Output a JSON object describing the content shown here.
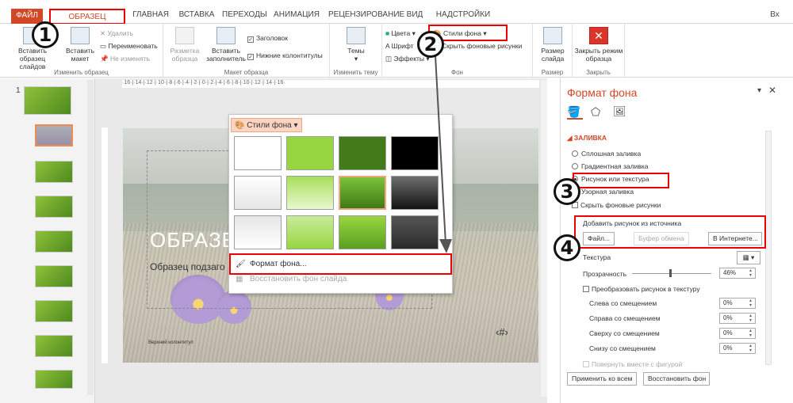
{
  "tabs": {
    "file": "ФАЙЛ",
    "items": [
      "ОБРАЗЕЦ СЛАЙДОВ",
      "ГЛАВНАЯ",
      "ВСТАВКА",
      "ПЕРЕХОДЫ",
      "АНИМАЦИЯ",
      "РЕЦЕНЗИРОВАНИЕ",
      "ВИД",
      "НАДСТРОЙКИ"
    ],
    "signin": "Вх"
  },
  "ribbon": {
    "edit_master": {
      "insert_master": "Вставить образец слайдов",
      "insert_layout": "Вставить макет",
      "delete": "Удалить",
      "rename": "Переименовать",
      "preserve": "Не изменять",
      "label": "Изменить образец"
    },
    "layout": {
      "master_layout": "Разметка образца",
      "insert_placeholder": "Вставить заполнитель",
      "title": "Заголовок",
      "footers": "Нижние колонтитулы",
      "label": "Макет образца"
    },
    "theme": {
      "themes": "Темы",
      "label": "Изменить тему"
    },
    "background": {
      "colors": "Цвета",
      "fonts": "Шрифт",
      "effects": "Эффекты",
      "bg_styles": "Стили фона",
      "hide_bg": "Скрыть фоновые рисунки",
      "label": "Фон"
    },
    "size": {
      "slide_size": "Размер слайда",
      "label": "Размер"
    },
    "close": {
      "close_master": "Закрыть режим образца",
      "label": "Закрыть"
    }
  },
  "annotations": [
    "1",
    "2",
    "3",
    "4"
  ],
  "slide": {
    "title": "ОБРАЗЕЦ",
    "subtitle": "Образец подзаго",
    "number": "‹#›",
    "footer": "Верхний колонтитул"
  },
  "popup": {
    "button": "Стили фона",
    "format_bg": "Формат фона...",
    "reset_bg": "Восстановить фон слайда"
  },
  "pane": {
    "title": "Формат фона",
    "section": "ЗАЛИВКА",
    "solid": "Сплошная заливка",
    "gradient": "Градиентная заливка",
    "picture": "Рисунок или текстура",
    "pattern": "Узорная заливка",
    "hide_bg": "Скрыть фоновые рисунки",
    "insert_from": "Добавить рисунок из источника",
    "file_btn": "Файл...",
    "clipboard_btn": "Буфер обмена",
    "online_btn": "В Интернете...",
    "texture": "Текстура",
    "transparency": "Прозрачность",
    "transparency_val": "46%",
    "tile": "Преобразовать рисунок в текстуру",
    "offset_left": "Слева со смещением",
    "offset_right": "Справа со смещением",
    "offset_top": "Сверху со смещением",
    "offset_bottom": "Снизу со смещением",
    "offset_val": "0%",
    "rotate": "Повернуть вместе с фигурой",
    "apply_all": "Применить ко всем",
    "reset": "Восстановить фон"
  },
  "ruler": {
    "h": "·16·|·14·|·12·|·10·|·8·|·6·|·4·|·2·|·0·|·2·|·4·|·6·|·8·|·10·|·12·|·14·|·16·"
  },
  "thumbnail_number": "1",
  "colors": {
    "accent": "#d24726",
    "annotation": "#ee0000",
    "slide_green": "#6ea82c"
  }
}
